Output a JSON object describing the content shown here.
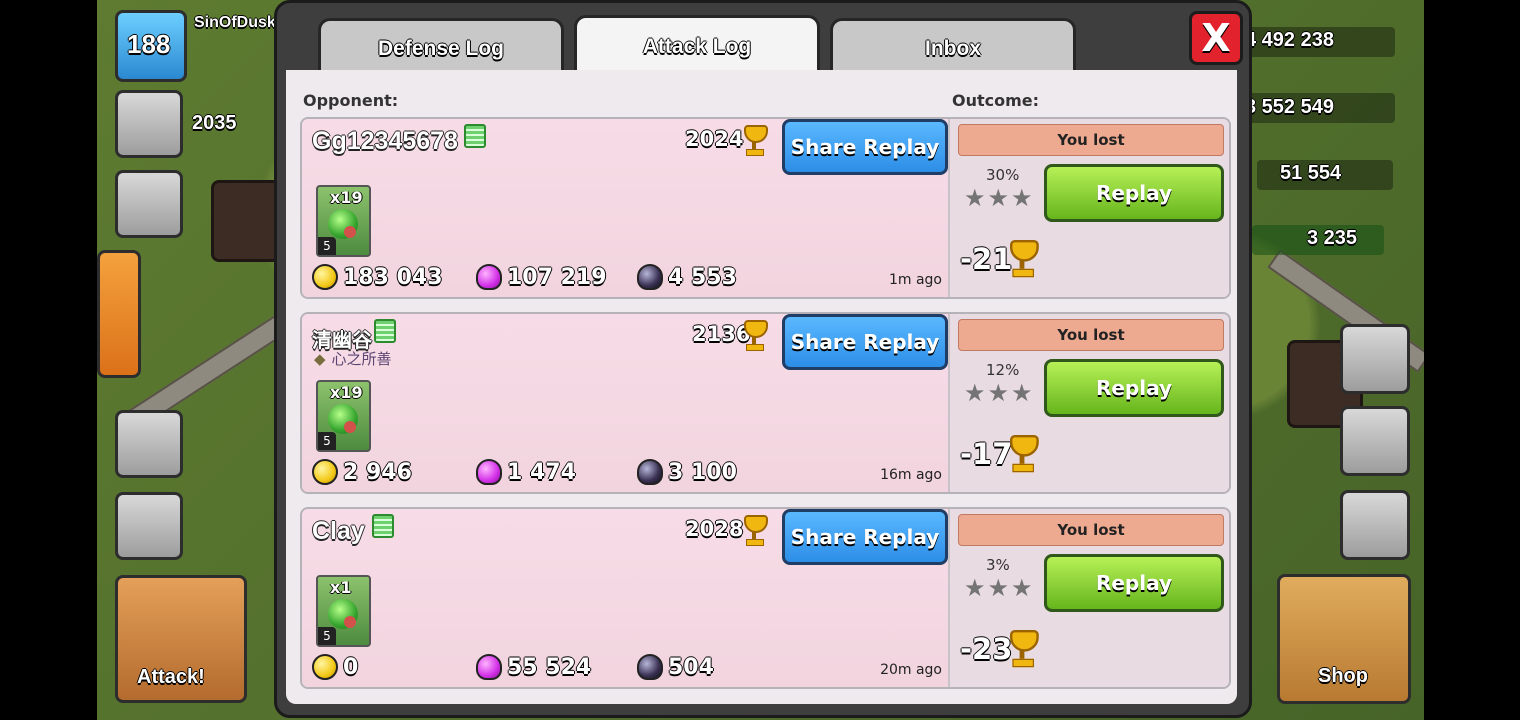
{
  "hud": {
    "level": "188",
    "player_name": "SinOfDusk",
    "trophies": "2035",
    "gold": "4 492 238",
    "elixir": "3 552 549",
    "dark_elixir": "51 554",
    "gems": "3 235",
    "attack_label": "Attack!",
    "shop_label": "Shop"
  },
  "modal": {
    "tabs": [
      "Defense Log",
      "Attack Log",
      "Inbox"
    ],
    "headers": {
      "opponent": "Opponent:",
      "outcome": "Outcome:"
    },
    "close_icon": "X"
  },
  "entries": [
    {
      "name": "Gg12345678",
      "clan": "",
      "trophies": "2024",
      "share_label": "Share Replay",
      "troop_count": "x19",
      "troop_level": "5",
      "gold": "183 043",
      "elixir": "107 219",
      "dark": "4 553",
      "time": "1m ago",
      "outcome": "You lost",
      "percent": "30%",
      "replay_label": "Replay",
      "trophy_change": "-21"
    },
    {
      "name": "清幽谷",
      "clan": "心之所善",
      "trophies": "2136",
      "share_label": "Share Replay",
      "troop_count": "x19",
      "troop_level": "5",
      "gold": "2 946",
      "elixir": "1 474",
      "dark": "3 100",
      "time": "16m ago",
      "outcome": "You lost",
      "percent": "12%",
      "replay_label": "Replay",
      "trophy_change": "-17"
    },
    {
      "name": "Clay",
      "clan": "",
      "trophies": "2028",
      "share_label": "Share Replay",
      "troop_count": "x1",
      "troop_level": "5",
      "gold": "0",
      "elixir": "55 524",
      "dark": "504",
      "time": "20m ago",
      "outcome": "You lost",
      "percent": "3%",
      "replay_label": "Replay",
      "trophy_change": "-23"
    }
  ],
  "colors": {
    "close_red": "#e2222c",
    "share_blue": "#2d8ee7",
    "replay_green": "#66b51c",
    "outcome_bg": "#eeaa90"
  }
}
